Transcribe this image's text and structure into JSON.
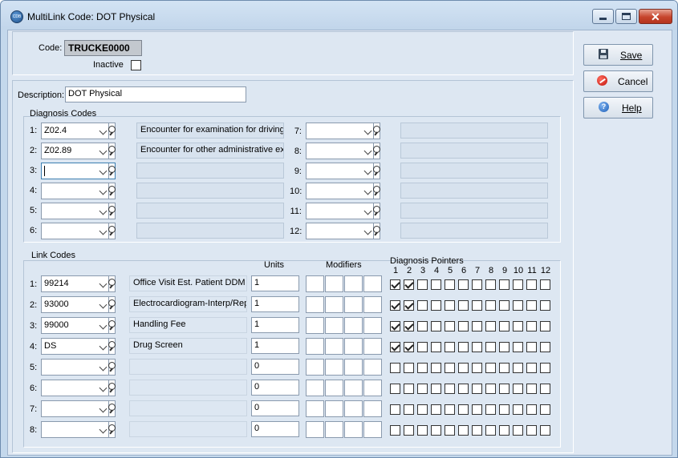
{
  "window": {
    "title": "MultiLink Code: DOT Physical",
    "icon_text": "CDB"
  },
  "header": {
    "code_label": "Code:",
    "code_value": "TRUCKE0000",
    "inactive_label": "Inactive",
    "inactive_checked": false
  },
  "description": {
    "label": "Description:",
    "value": "DOT Physical"
  },
  "diagnosis": {
    "section_label": "Diagnosis Codes",
    "left": [
      {
        "label": "1:",
        "code": "Z02.4",
        "desc": "Encounter for examination for driving"
      },
      {
        "label": "2:",
        "code": "Z02.89",
        "desc": "Encounter for other administrative ex"
      },
      {
        "label": "3:",
        "code": "",
        "desc": ""
      },
      {
        "label": "4:",
        "code": "",
        "desc": ""
      },
      {
        "label": "5:",
        "code": "",
        "desc": ""
      },
      {
        "label": "6:",
        "code": "",
        "desc": ""
      }
    ],
    "right": [
      {
        "label": "7:",
        "code": "",
        "desc": ""
      },
      {
        "label": "8:",
        "code": "",
        "desc": ""
      },
      {
        "label": "9:",
        "code": "",
        "desc": ""
      },
      {
        "label": "10:",
        "code": "",
        "desc": ""
      },
      {
        "label": "11:",
        "code": "",
        "desc": ""
      },
      {
        "label": "12:",
        "code": "",
        "desc": ""
      }
    ]
  },
  "link_codes": {
    "section_label": "Link Codes",
    "units_header": "Units",
    "modifiers_header": "Modifiers",
    "pointers_header": "Diagnosis Pointers",
    "pointer_numbers": [
      "1",
      "2",
      "3",
      "4",
      "5",
      "6",
      "7",
      "8",
      "9",
      "10",
      "11",
      "12"
    ],
    "rows": [
      {
        "label": "1:",
        "code": "99214",
        "desc": "Office Visit Est. Patient DDM",
        "units": "1",
        "pointers": [
          1,
          2
        ]
      },
      {
        "label": "2:",
        "code": "93000",
        "desc": "Electrocardiogram-Interp/Rep",
        "units": "1",
        "pointers": [
          1,
          2
        ]
      },
      {
        "label": "3:",
        "code": "99000",
        "desc": "Handling Fee",
        "units": "1",
        "pointers": [
          1,
          2
        ]
      },
      {
        "label": "4:",
        "code": "DS",
        "desc": "Drug Screen",
        "units": "1",
        "pointers": [
          1,
          2
        ]
      },
      {
        "label": "5:",
        "code": "",
        "desc": "",
        "units": "0",
        "pointers": []
      },
      {
        "label": "6:",
        "code": "",
        "desc": "",
        "units": "0",
        "pointers": []
      },
      {
        "label": "7:",
        "code": "",
        "desc": "",
        "units": "0",
        "pointers": []
      },
      {
        "label": "8:",
        "code": "",
        "desc": "",
        "units": "0",
        "pointers": []
      }
    ]
  },
  "buttons": {
    "save": "Save",
    "cancel": "Cancel",
    "help": "Help"
  },
  "icons": {
    "save": "floppy-disk-icon",
    "cancel": "cancel-icon",
    "help": "help-icon"
  }
}
